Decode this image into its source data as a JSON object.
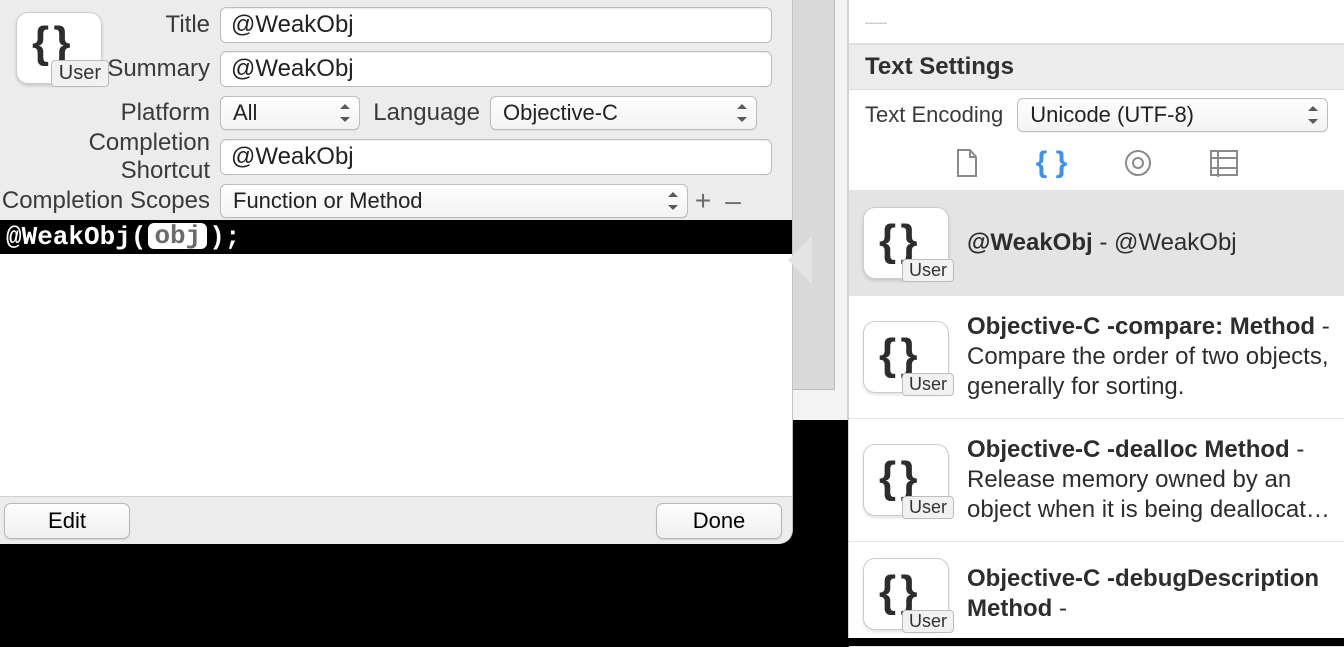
{
  "form": {
    "labels": {
      "title": "Title",
      "summary": "Summary",
      "platform": "Platform",
      "language": "Language",
      "completion_shortcut": "Completion Shortcut",
      "completion_scopes": "Completion Scopes"
    },
    "values": {
      "title": "@WeakObj",
      "summary": "@WeakObj",
      "platform": "All",
      "language": "Objective-C",
      "completion_shortcut": "@WeakObj",
      "completion_scopes": "Function or Method"
    },
    "badge_tag": "User"
  },
  "code": {
    "prefix": "@WeakObj(",
    "token": "obj",
    "suffix": ");"
  },
  "buttons": {
    "edit": "Edit",
    "done": "Done",
    "add": "+",
    "remove": "–"
  },
  "right": {
    "section_header": "Text Settings",
    "encoding_label": "Text Encoding",
    "encoding_value": "Unicode (UTF-8)",
    "badge_tag": "User",
    "snippets": [
      {
        "title": "@WeakObj",
        "desc_sep": " - ",
        "desc": "@WeakObj",
        "selected": true
      },
      {
        "title": "Objective-C -compare: Method",
        "desc_sep": " - ",
        "desc": "Compare the order of two objects, generally for sorting.",
        "selected": false
      },
      {
        "title": "Objective-C -dealloc Method",
        "desc_sep": " - ",
        "desc": "Release memory owned by an object when it is being deallocat…",
        "selected": false
      },
      {
        "title": "Objective-C -debugDescription Method",
        "desc_sep": " - ",
        "desc": "",
        "selected": false
      }
    ]
  }
}
